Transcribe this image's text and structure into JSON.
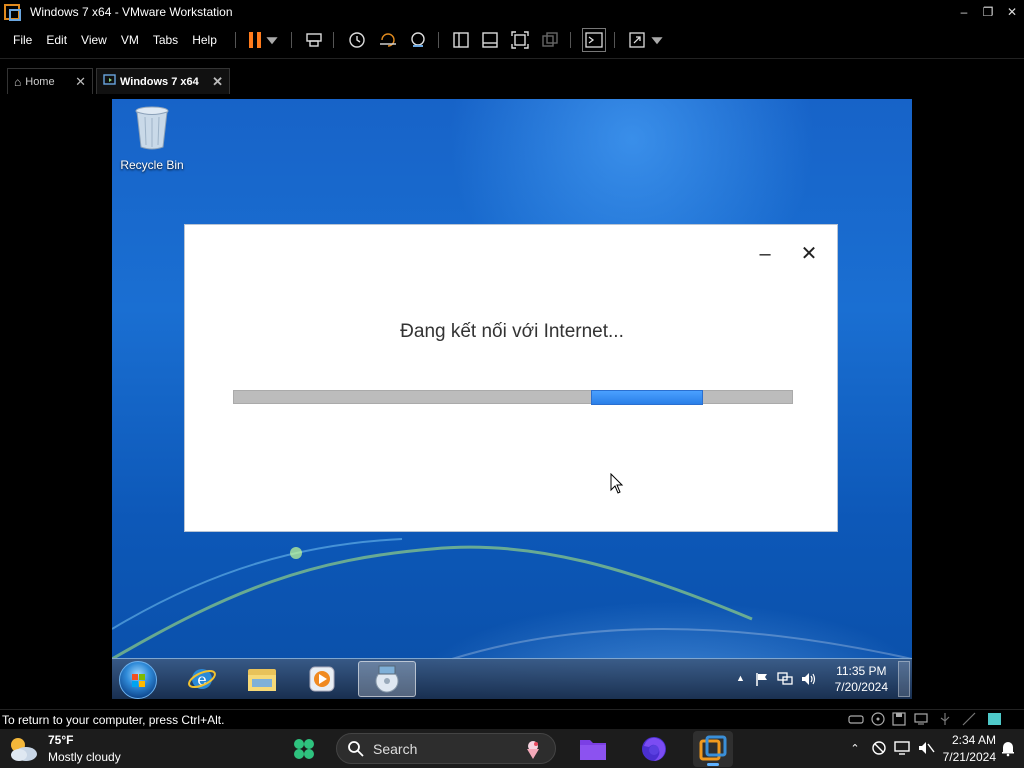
{
  "window": {
    "title": "Windows 7 x64 - VMware Workstation",
    "controls": {
      "minimize": "–",
      "maximize": "❐",
      "close": "✕"
    }
  },
  "menu": [
    "File",
    "Edit",
    "View",
    "VM",
    "Tabs",
    "Help"
  ],
  "toolbar": {
    "icons": [
      "pause-icon",
      "dropdown-icon",
      "send-ctrl-alt-del-icon",
      "snapshot-icon",
      "revert-snapshot-icon",
      "snapshot-manager-icon",
      "library-icon",
      "single-window-icon",
      "full-screen-icon",
      "unity-icon",
      "console-icon",
      "stretch-icon",
      "dropdown-icon"
    ],
    "accent": "#ff7b1c"
  },
  "tabs": [
    {
      "label": "Home",
      "icon": "home-icon",
      "close": "✕"
    },
    {
      "label": "Windows 7 x64",
      "icon": "vm-icon",
      "close": "✕",
      "active": true
    }
  ],
  "guest": {
    "desktop_icons": [
      {
        "label": "Recycle Bin",
        "icon": "recycle-bin-icon"
      }
    ],
    "dialog": {
      "minimize": "–",
      "close": "✕",
      "message": "Đang kết nối với Internet...",
      "progress": {
        "mode": "indeterminate",
        "chunk_start": 0.64,
        "chunk_end": 0.84
      }
    },
    "taskbar": {
      "apps": [
        "internet-explorer-icon",
        "windows-explorer-icon",
        "media-player-icon",
        "installer-icon"
      ],
      "clock_time": "11:35 PM",
      "clock_date": "7/20/2024",
      "tray_icons": [
        "show-hidden-icons-icon",
        "action-center-flag-icon",
        "network-icon",
        "volume-icon"
      ]
    }
  },
  "statusbar": {
    "text": "To return to your computer, press Ctrl+Alt.",
    "icons": [
      "hard-disk-icon",
      "cd-dvd-icon",
      "floppy-icon",
      "network-adapter-icon",
      "usb-icon",
      "message-icon"
    ]
  },
  "host_taskbar": {
    "weather": {
      "temp": "75°F",
      "condition": "Mostly cloudy"
    },
    "search_label": "Search",
    "apps": [
      "widgets-icon",
      "search-icon",
      "files-icon",
      "firefox-icon",
      "vmware-icon"
    ],
    "clock_time": "2:34 AM",
    "clock_date": "7/21/2024",
    "tray_icons": [
      "chevron-up-icon",
      "network-off-icon",
      "display-icon",
      "mute-icon",
      "notification-bell-icon"
    ]
  },
  "colors": {
    "desktop_blue": "#1763c8",
    "progress_fill": "#2a7fe8",
    "progress_track": "#bcbcbc",
    "host_taskbar": "#1c1c1c"
  }
}
